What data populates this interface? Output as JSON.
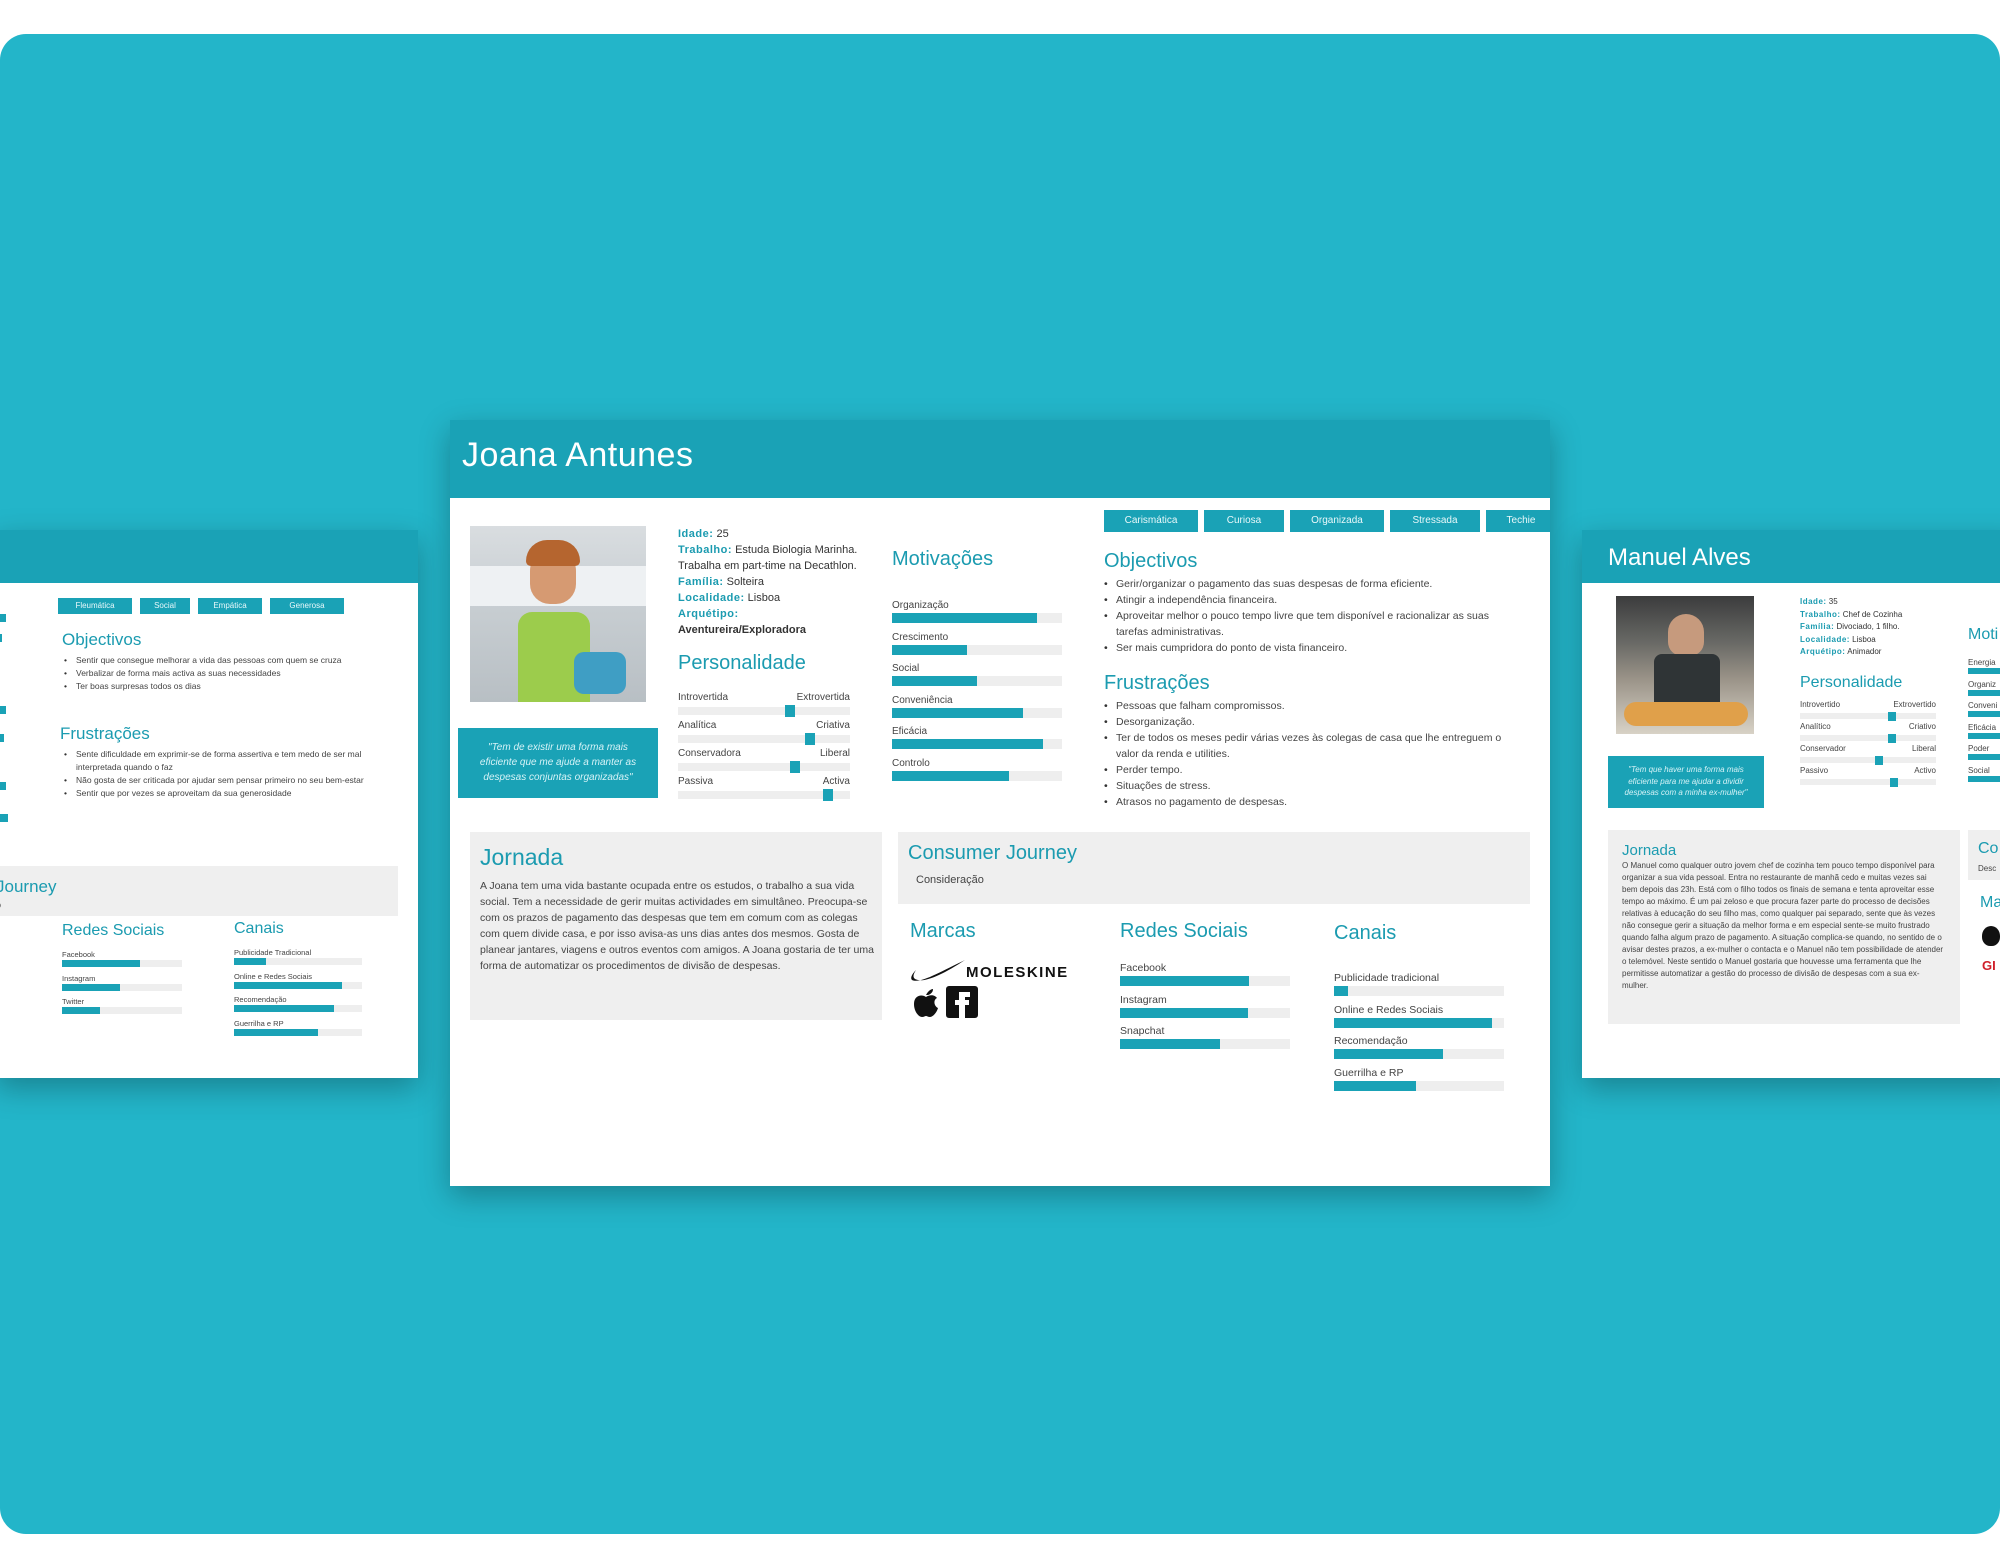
{
  "center": {
    "name": "Joana Antunes",
    "info": [
      {
        "k": "Idade:",
        "v": " 25"
      },
      {
        "k": "Trabalho:",
        "v": " Estuda Biologia Marinha."
      },
      {
        "k": "",
        "v": "Trabalha em part-time na Decathlon."
      },
      {
        "k": "Família:",
        "v": " Solteira"
      },
      {
        "k": "Localidade:",
        "v": " Lisboa"
      },
      {
        "k": "Arquétipo:",
        "v": ""
      },
      {
        "k": "",
        "v": "Aventureira/Exploradora"
      }
    ],
    "tags": [
      "Carismática",
      "Curiosa",
      "Organizada",
      "Stressada",
      "Techie"
    ],
    "quote": "\"Tem de existir uma forma mais eficiente que me ajude a manter as despesas conjuntas organizadas\"",
    "personalidade_title": "Personalidade",
    "personalidade": [
      {
        "left": "Introvertida",
        "right": "Extrovertida",
        "level": 0.65
      },
      {
        "left": "Analítica",
        "right": "Criativa",
        "level": 0.77
      },
      {
        "left": "Conservadora",
        "right": "Liberal",
        "level": 0.68
      },
      {
        "left": "Passiva",
        "right": "Activa",
        "level": 0.87
      }
    ],
    "motivacoes_title": "Motivações",
    "motivacoes": [
      {
        "label": "Organização",
        "value": 0.85
      },
      {
        "label": "Crescimento",
        "value": 0.44
      },
      {
        "label": "Social",
        "value": 0.5
      },
      {
        "label": "Conveniência",
        "value": 0.77
      },
      {
        "label": "Eficácia",
        "value": 0.89
      },
      {
        "label": "Controlo",
        "value": 0.69
      }
    ],
    "objectivos_title": "Objectivos",
    "objectivos": [
      "Gerir/organizar o pagamento das suas despesas de forma eficiente.",
      "Atingir a independência financeira.",
      "Aproveitar melhor o pouco tempo livre que tem disponível e racionalizar as suas tarefas administrativas.",
      "Ser mais cumpridora do ponto de vista financeiro."
    ],
    "frustracoes_title": "Frustrações",
    "frustracoes": [
      "Pessoas que falham compromissos.",
      "Desorganização.",
      "Ter de todos os meses pedir várias vezes às colegas de casa que lhe entreguem o valor da renda e utilities.",
      "Perder tempo.",
      "Situações de stress.",
      "Atrasos no pagamento de despesas."
    ],
    "jornada_title": "Jornada",
    "jornada": "A Joana  tem uma vida bastante ocupada entre os estudos,  o trabalho a sua vida social. Tem a necessidade de gerir muitas actividades em simultâneo. Preocupa-se com os prazos de pagamento das despesas que tem em comum com as colegas com quem divide casa, e por isso avisa-as uns dias antes dos mesmos. Gosta de planear jantares, viagens e outros eventos com amigos. A Joana gostaria de ter uma forma de automatizar os procedimentos de divisão de despesas.",
    "consumer_title": "Consumer Journey",
    "consumer_sub": "Consideração",
    "marcas_title": "Marcas",
    "moleskine": "MOLESKINE",
    "redes_title": "Redes Sociais",
    "redes": [
      {
        "label": "Facebook",
        "value": 0.76
      },
      {
        "label": "Instagram",
        "value": 0.75
      },
      {
        "label": "Snapchat",
        "value": 0.59
      }
    ],
    "canais_title": "Canais",
    "canais": [
      {
        "label": "Publicidade tradicional",
        "value": 0.08
      },
      {
        "label": "Online e Redes Sociais",
        "value": 0.93
      },
      {
        "label": "Recomendação",
        "value": 0.64
      },
      {
        "label": "Guerrilha e RP",
        "value": 0.48
      }
    ]
  },
  "left": {
    "tags": [
      "Fleumática",
      "Social",
      "Empática",
      "Generosa"
    ],
    "objectivos_title": "Objectivos",
    "objectivos": [
      "Sentir que consegue melhorar a vida das pessoas com quem se cruza",
      "Verbalizar de forma mais activa as suas necessidades",
      "Ter boas surpresas todos os dias"
    ],
    "frustracoes_title": "Frustrações",
    "frustracoes": [
      "Sente dificuldade em exprimir-se de forma assertiva e tem medo de ser mal interpretada quando o faz",
      "Não gosta de ser criticada por ajudar sem pensar primeiro no seu bem-estar",
      "Sentir que por vezes se aproveitam da sua generosidade"
    ],
    "journey_title": "Journey",
    "journey_sub": "o",
    "redes_title": "Redes Sociais",
    "redes": [
      {
        "label": "Facebook",
        "value": 0.65
      },
      {
        "label": "Instagram",
        "value": 0.48
      },
      {
        "label": "Twitter",
        "value": 0.32
      }
    ],
    "canais_title": "Canais",
    "canais": [
      {
        "label": "Publicidade Tradicional",
        "value": 0.25
      },
      {
        "label": "Online e Redes Sociais",
        "value": 0.84
      },
      {
        "label": "Recomendação",
        "value": 0.78
      },
      {
        "label": "Guerrilha e RP",
        "value": 0.66
      }
    ]
  },
  "right": {
    "name": "Manuel Alves",
    "info": [
      {
        "k": "Idade:",
        "v": " 35"
      },
      {
        "k": "Trabalho:",
        "v": " Chef de Cozinha"
      },
      {
        "k": "Família:",
        "v": " Divociado, 1 filho."
      },
      {
        "k": "Localidade:",
        "v": " Lisboa"
      },
      {
        "k": "Arquétipo:",
        "v": " Animador"
      }
    ],
    "quote": "\"Tem que haver uma forma mais eficiente para me ajudar a dividir despesas com a minha ex-mulher\"",
    "personalidade_title": "Personalidade",
    "personalidade": [
      {
        "left": "Introvertido",
        "right": "Extrovertido",
        "level": 0.68
      },
      {
        "left": "Analítico",
        "right": "Criativo",
        "level": 0.68
      },
      {
        "left": "Conservador",
        "right": "Liberal",
        "level": 0.58
      },
      {
        "left": "Passivo",
        "right": "Activo",
        "level": 0.69
      }
    ],
    "moti_title": "Moti",
    "moti": [
      {
        "label": "Energia",
        "value": 1
      },
      {
        "label": "Organiz",
        "value": 1
      },
      {
        "label": "Conveni",
        "value": 1
      },
      {
        "label": "Eficácia",
        "value": 1
      },
      {
        "label": "Poder",
        "value": 1
      },
      {
        "label": "Social",
        "value": 1
      }
    ],
    "jornada_title": "Jornada",
    "jornada": "O Manuel como qualquer outro jovem chef de cozinha tem pouco tempo disponível para organizar a sua vida pessoal. Entra no restaurante de manhã cedo e muitas vezes sai bem depois das 23h. Está com o filho todos os finais de semana e tenta aproveitar esse tempo ao máximo. É um pai zeloso e que procura fazer parte do processo de decisões relativas à educação do seu filho mas, como qualquer pai separado, sente que às vezes não consegue gerir a situação da melhor forma e em especial sente-se muito frustrado quando falha algum prazo de pagamento. A situação complica-se quando, no sentido de o avisar destes prazos, a ex-mulher o contacta e o Manuel não tem possibilidade de atender o telemóvel. Neste sentido o Manuel gostaria que houvesse uma ferramenta que lhe permitisse automatizar a gestão do processo de divisão de despesas com a sua ex-mulher.",
    "co_title": "Co",
    "co_sub": "Desc",
    "ma_title": "Ma",
    "gi": "GI"
  }
}
